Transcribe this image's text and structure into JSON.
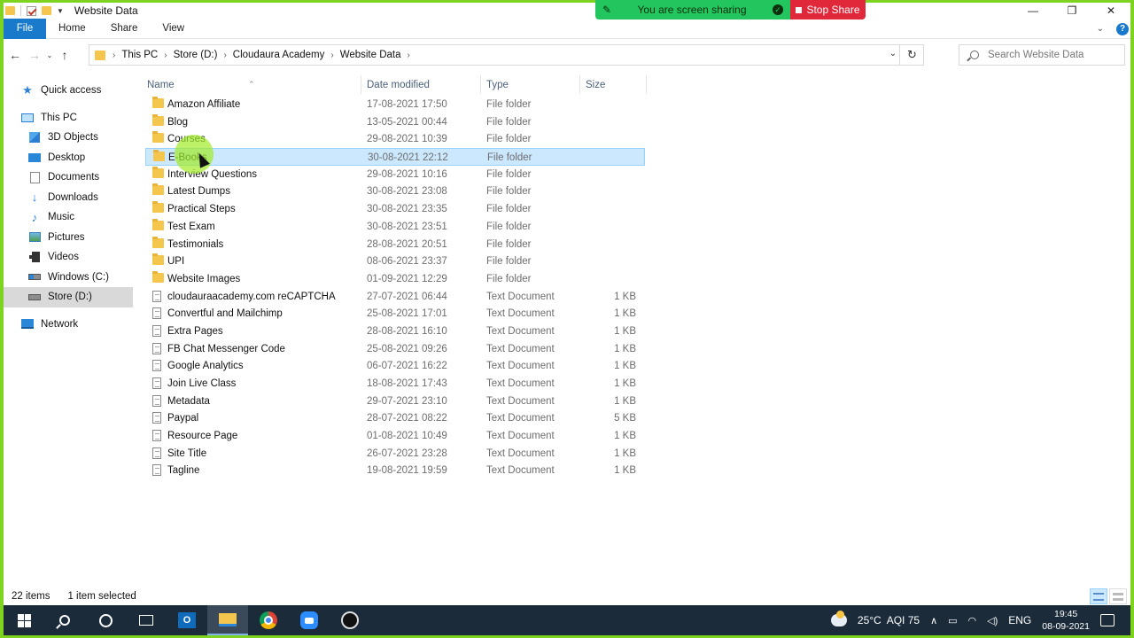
{
  "window": {
    "title": "Website Data",
    "minimize": "—",
    "restore": "❐",
    "close": "✕"
  },
  "screen_share": {
    "status": "You are screen sharing",
    "stop_label": "Stop Share",
    "status_color": "#22c55e",
    "stop_color": "#e0283a"
  },
  "ribbon": {
    "tabs": [
      "File",
      "Home",
      "Share",
      "View"
    ],
    "accent": "#1979ca"
  },
  "address_bar": {
    "breadcrumbs": [
      "This PC",
      "Store (D:)",
      "Cloudaura Academy",
      "Website Data"
    ]
  },
  "search": {
    "placeholder": "Search Website Data"
  },
  "sidebar": {
    "quick_access": "Quick access",
    "this_pc": "This PC",
    "pc_items": [
      "3D Objects",
      "Desktop",
      "Documents",
      "Downloads",
      "Music",
      "Pictures",
      "Videos",
      "Windows (C:)",
      "Store (D:)"
    ],
    "network": "Network"
  },
  "columns": {
    "name": "Name",
    "date": "Date modified",
    "type": "Type",
    "size": "Size"
  },
  "files": [
    {
      "name": "Amazon Affiliate",
      "date": "17-08-2021 17:50",
      "type": "File folder",
      "size": ""
    },
    {
      "name": "Blog",
      "date": "13-05-2021 00:44",
      "type": "File folder",
      "size": ""
    },
    {
      "name": "Courses",
      "date": "29-08-2021 10:39",
      "type": "File folder",
      "size": ""
    },
    {
      "name": "E-Books",
      "date": "30-08-2021 22:12",
      "type": "File folder",
      "size": ""
    },
    {
      "name": "Interview Questions",
      "date": "29-08-2021 10:16",
      "type": "File folder",
      "size": ""
    },
    {
      "name": "Latest Dumps",
      "date": "30-08-2021 23:08",
      "type": "File folder",
      "size": ""
    },
    {
      "name": "Practical Steps",
      "date": "30-08-2021 23:35",
      "type": "File folder",
      "size": ""
    },
    {
      "name": "Test Exam",
      "date": "30-08-2021 23:51",
      "type": "File folder",
      "size": ""
    },
    {
      "name": "Testimonials",
      "date": "28-08-2021 20:51",
      "type": "File folder",
      "size": ""
    },
    {
      "name": "UPI",
      "date": "08-06-2021 23:37",
      "type": "File folder",
      "size": ""
    },
    {
      "name": "Website Images",
      "date": "01-09-2021 12:29",
      "type": "File folder",
      "size": ""
    },
    {
      "name": "cloudauraacademy.com reCAPTCHA",
      "date": "27-07-2021 06:44",
      "type": "Text Document",
      "size": "1 KB"
    },
    {
      "name": "Convertful and Mailchimp",
      "date": "25-08-2021 17:01",
      "type": "Text Document",
      "size": "1 KB"
    },
    {
      "name": "Extra Pages",
      "date": "28-08-2021 16:10",
      "type": "Text Document",
      "size": "1 KB"
    },
    {
      "name": "FB Chat Messenger Code",
      "date": "25-08-2021 09:26",
      "type": "Text Document",
      "size": "1 KB"
    },
    {
      "name": "Google Analytics",
      "date": "06-07-2021 16:22",
      "type": "Text Document",
      "size": "1 KB"
    },
    {
      "name": "Join Live Class",
      "date": "18-08-2021 17:43",
      "type": "Text Document",
      "size": "1 KB"
    },
    {
      "name": "Metadata",
      "date": "29-07-2021 23:10",
      "type": "Text Document",
      "size": "1 KB"
    },
    {
      "name": "Paypal",
      "date": "28-07-2021 08:22",
      "type": "Text Document",
      "size": "5 KB"
    },
    {
      "name": "Resource Page",
      "date": "01-08-2021 10:49",
      "type": "Text Document",
      "size": "1 KB"
    },
    {
      "name": "Site Title",
      "date": "26-07-2021 23:28",
      "type": "Text Document",
      "size": "1 KB"
    },
    {
      "name": "Tagline",
      "date": "19-08-2021 19:59",
      "type": "Text Document",
      "size": "1 KB"
    }
  ],
  "selected_file": "E-Books",
  "status_bar": {
    "item_count": "22 items",
    "selection": "1 item selected"
  },
  "taskbar": {
    "outlook_letter": "O",
    "weather": "25°C",
    "aqi": "AQI 75",
    "language": "ENG",
    "time": "19:45",
    "date": "08-09-2021"
  }
}
